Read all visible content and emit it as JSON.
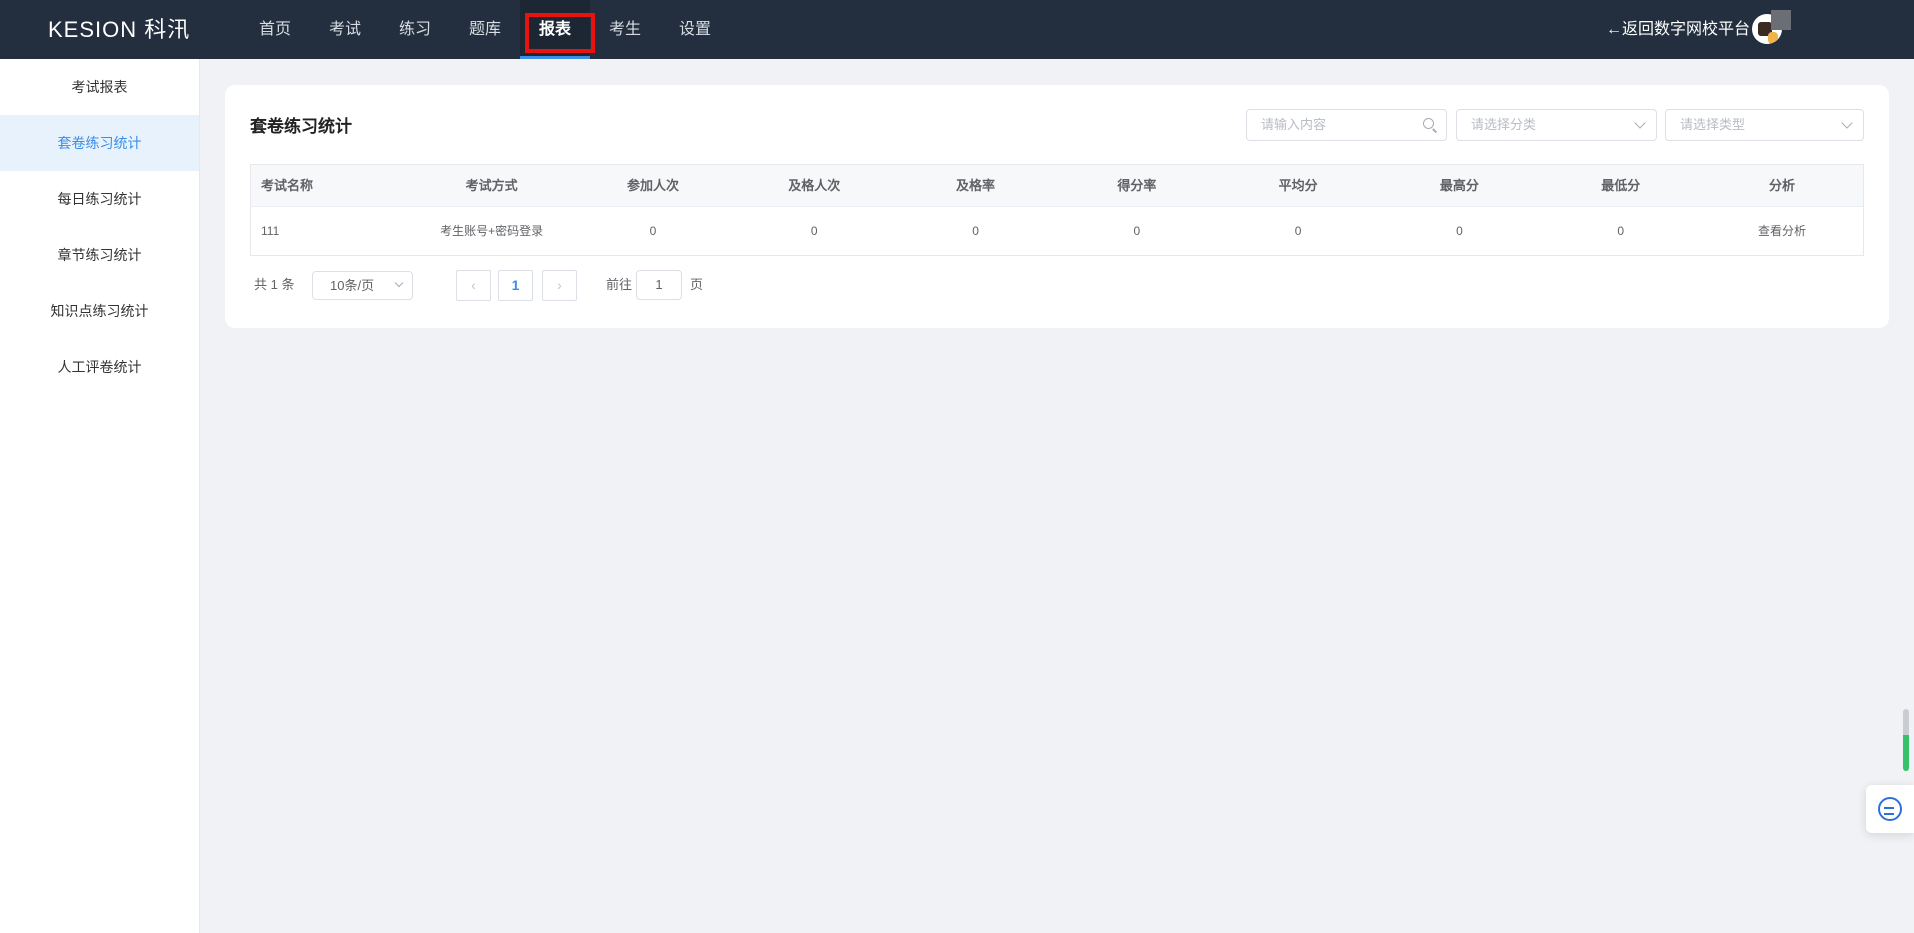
{
  "header": {
    "logo": "KESION 科汛",
    "nav": [
      {
        "label": "首页"
      },
      {
        "label": "考试"
      },
      {
        "label": "练习"
      },
      {
        "label": "题库"
      },
      {
        "label": "报表"
      },
      {
        "label": "考生"
      },
      {
        "label": "设置"
      }
    ],
    "active_nav": "报表",
    "back_link": "←返回数字网校平台"
  },
  "sidebar": {
    "items": [
      {
        "label": "考试报表"
      },
      {
        "label": "套卷练习统计"
      },
      {
        "label": "每日练习统计"
      },
      {
        "label": "章节练习统计"
      },
      {
        "label": "知识点练习统计"
      },
      {
        "label": "人工评卷统计"
      }
    ],
    "active": "套卷练习统计"
  },
  "main": {
    "title": "套卷练习统计",
    "search_placeholder": "请输入内容",
    "category_placeholder": "请选择分类",
    "type_placeholder": "请选择类型",
    "table": {
      "columns": [
        "考试名称",
        "考试方式",
        "参加人次",
        "及格人次",
        "及格率",
        "得分率",
        "平均分",
        "最高分",
        "最低分",
        "分析"
      ],
      "rows": [
        [
          "111",
          "考生账号+密码登录",
          "0",
          "0",
          "0",
          "0",
          "0",
          "0",
          "0",
          "查看分析"
        ]
      ]
    },
    "pagination": {
      "total": "共 1 条",
      "page_size": "10条/页",
      "prev": "‹",
      "current_page": "1",
      "next": "›",
      "goto_label": "前往",
      "goto_value": "1",
      "page_suffix": "页"
    }
  },
  "colors": {
    "topbar": "#232f3e",
    "accent": "#3a8ee6",
    "highlight_box": "#e8130e"
  }
}
